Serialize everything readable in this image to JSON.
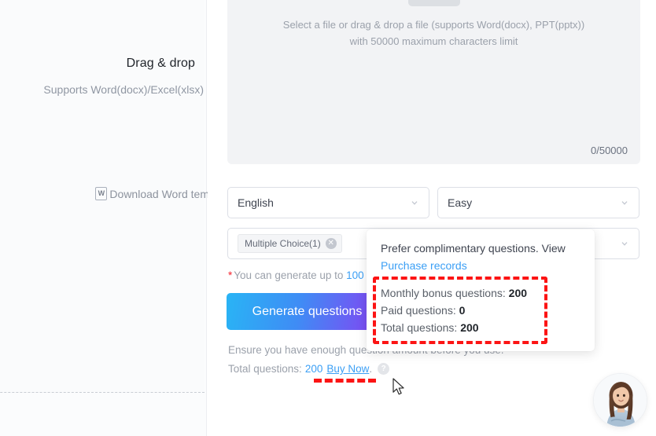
{
  "left_panel": {
    "title": "Drag & drop",
    "subtitle": "Supports Word(docx)/Excel(xlsx)",
    "download_label": "Download Word tem",
    "word_badge": "W"
  },
  "upload": {
    "select_button_label": "",
    "hint_line1": "Select a file or drag & drop a file (supports Word(docx), PPT(pptx))",
    "hint_line2": "with 50000 maximum characters limit",
    "char_count": "0/50000"
  },
  "selects": {
    "language": {
      "value": "English",
      "caret": "chevron-down-icon"
    },
    "difficulty": {
      "value": "Easy",
      "caret": "chevron-down-icon"
    },
    "question_types": {
      "chips": [
        {
          "label": "Multiple Choice(1)",
          "remove": "✕"
        }
      ],
      "caret": "chevron-down-icon"
    }
  },
  "note": {
    "star": "*",
    "text_before": "You can generate up to ",
    "limit": "100"
  },
  "actions": {
    "generate_label": "Generate questions",
    "ensure_text": "Ensure you have enough question amount before you use.",
    "total_label": "Total questions:",
    "total_value": "200",
    "buy_label": "Buy Now",
    "buy_period": ".",
    "help_icon_glyph": "?"
  },
  "popover": {
    "headline": "Prefer complimentary questions. View",
    "link": "Purchase records",
    "stats": [
      {
        "label": "Monthly bonus questions:",
        "value": "200"
      },
      {
        "label": "Paid questions:",
        "value": "0"
      },
      {
        "label": "Total questions:",
        "value": "200"
      }
    ]
  },
  "annotations": {
    "stats_box": "red-dashed-highlight",
    "buy_now_underline": "red-dashed-underline"
  },
  "chat_widget": {
    "name": "support-agent-avatar"
  },
  "colors": {
    "accent_link": "#3b9ff5",
    "required_star": "#f5222d",
    "annotation_red": "#fc1414",
    "button_gradient_start": "#29b4f5",
    "button_gradient_end": "#8b3cf2",
    "upload_box_bg": "#f2f3f5",
    "text_muted": "#9ba1ab"
  }
}
